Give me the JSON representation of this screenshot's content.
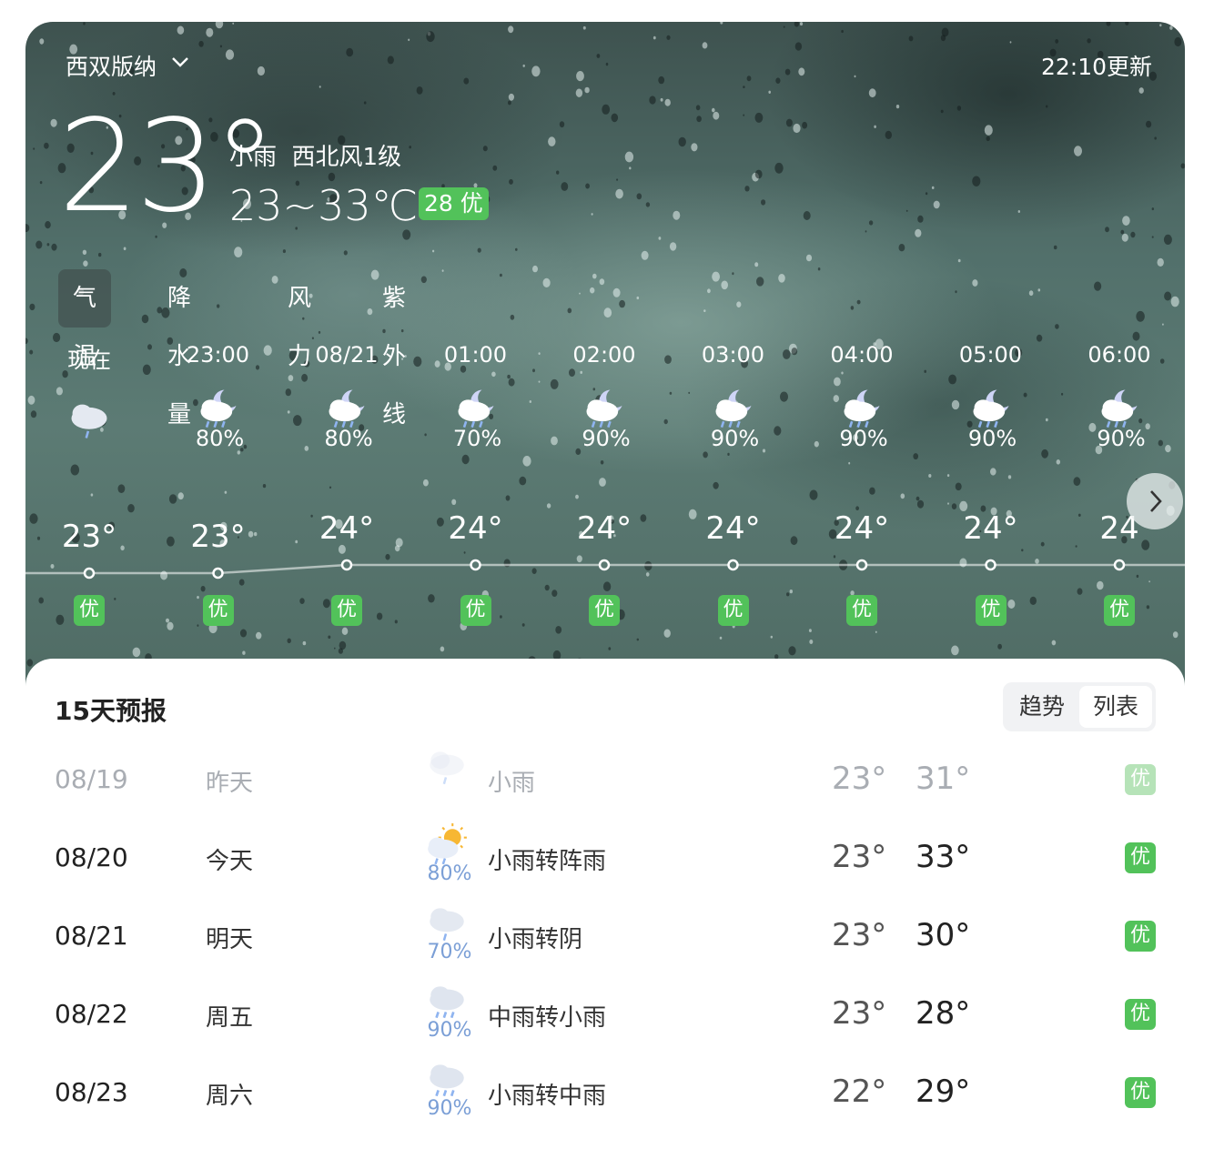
{
  "header": {
    "city": "西双版纳",
    "updated": "22:10更新",
    "current_temp": "23°",
    "condition": "小雨",
    "wind": "西北风1级",
    "range": "23~33℃",
    "aqi": "28 优"
  },
  "tabs": [
    "气温",
    "降水量",
    "风力",
    "紫外线"
  ],
  "hourly": [
    {
      "time": "现在",
      "icon": "cloud-rain-icon",
      "pct": "",
      "temp": "23°",
      "temp_value": 23,
      "aqi": "优"
    },
    {
      "time": "23:00",
      "icon": "moon-rain-icon",
      "pct": "80%",
      "temp": "23°",
      "temp_value": 23,
      "aqi": "优"
    },
    {
      "time": "08/21",
      "icon": "moon-rain-icon",
      "pct": "80%",
      "temp": "24°",
      "temp_value": 24,
      "aqi": "优"
    },
    {
      "time": "01:00",
      "icon": "moon-rain-icon",
      "pct": "70%",
      "temp": "24°",
      "temp_value": 24,
      "aqi": "优"
    },
    {
      "time": "02:00",
      "icon": "moon-rain-icon",
      "pct": "90%",
      "temp": "24°",
      "temp_value": 24,
      "aqi": "优"
    },
    {
      "time": "03:00",
      "icon": "moon-rain-icon",
      "pct": "90%",
      "temp": "24°",
      "temp_value": 24,
      "aqi": "优"
    },
    {
      "time": "04:00",
      "icon": "moon-rain-icon",
      "pct": "90%",
      "temp": "24°",
      "temp_value": 24,
      "aqi": "优"
    },
    {
      "time": "05:00",
      "icon": "moon-rain-icon",
      "pct": "90%",
      "temp": "24°",
      "temp_value": 24,
      "aqi": "优"
    },
    {
      "time": "06:00",
      "icon": "moon-rain-icon",
      "pct": "90%",
      "temp": "24",
      "temp_value": 24,
      "aqi": "优"
    }
  ],
  "forecast": {
    "title": "15天预报",
    "toggle": {
      "trend": "趋势",
      "list": "列表",
      "selected": "列表"
    },
    "days": [
      {
        "date": "08/19",
        "day": "昨天",
        "icon": "cloud-rain-icon",
        "pct": "",
        "condition": "小雨",
        "low": "23°",
        "high": "31°",
        "aqi": "优",
        "past": true
      },
      {
        "date": "08/20",
        "day": "今天",
        "icon": "sun-cloud-rain-icon",
        "pct": "80%",
        "condition": "小雨转阵雨",
        "low": "23°",
        "high": "33°",
        "aqi": "优",
        "past": false
      },
      {
        "date": "08/21",
        "day": "明天",
        "icon": "cloud-rain-icon",
        "pct": "70%",
        "condition": "小雨转阴",
        "low": "23°",
        "high": "30°",
        "aqi": "优",
        "past": false
      },
      {
        "date": "08/22",
        "day": "周五",
        "icon": "cloud-heavy-rain-icon",
        "pct": "90%",
        "condition": "中雨转小雨",
        "low": "23°",
        "high": "28°",
        "aqi": "优",
        "past": false
      },
      {
        "date": "08/23",
        "day": "周六",
        "icon": "cloud-heavy-rain-icon",
        "pct": "90%",
        "condition": "小雨转中雨",
        "low": "22°",
        "high": "29°",
        "aqi": "优",
        "past": false
      }
    ]
  },
  "colors": {
    "aqi_good": "#52c25a",
    "precip_text": "#7b9fd6",
    "background_top": "#3e524f"
  }
}
